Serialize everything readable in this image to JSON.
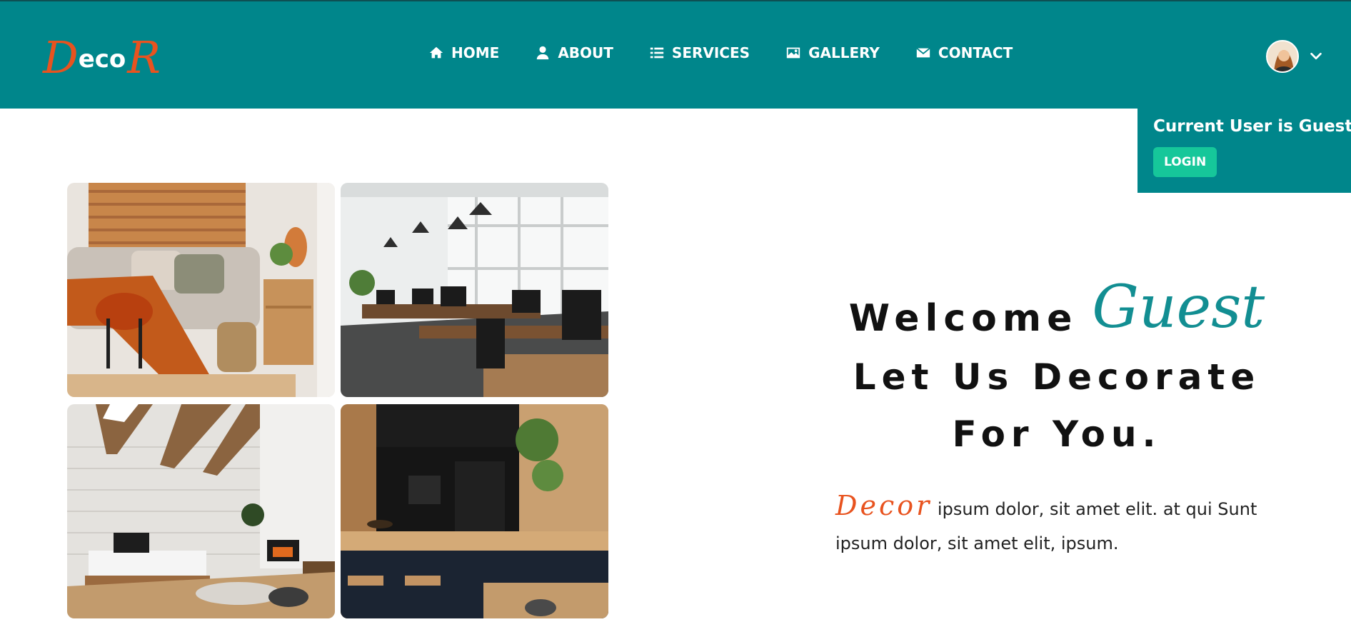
{
  "brand": {
    "logo_first": "D",
    "logo_mid": "eco",
    "logo_last": "R"
  },
  "nav": {
    "items": [
      {
        "label": "HOME",
        "icon": "home-icon"
      },
      {
        "label": "ABOUT",
        "icon": "user-icon"
      },
      {
        "label": "SERVICES",
        "icon": "list-icon"
      },
      {
        "label": "GALLERY",
        "icon": "image-icon"
      },
      {
        "label": "CONTACT",
        "icon": "envelope-icon"
      }
    ]
  },
  "user_menu": {
    "current_user_text": "Current User is Guest",
    "login_label": "LOGIN"
  },
  "hero": {
    "welcome": "Welcome",
    "name": "Guest",
    "tagline_line1": "Let Us Decorate",
    "tagline_line2": "For You.",
    "brand_word": "Decor",
    "description": "ipsum dolor, sit amet elit. at qui Sunt ipsum dolor, sit amet elit, ipsum."
  },
  "gallery": {
    "images": [
      "living-room",
      "office",
      "attic-bedroom",
      "kitchen"
    ]
  },
  "colors": {
    "primary": "#00868b",
    "accent": "#e8531f",
    "button": "#16c79a",
    "guest_text": "#128e92"
  }
}
